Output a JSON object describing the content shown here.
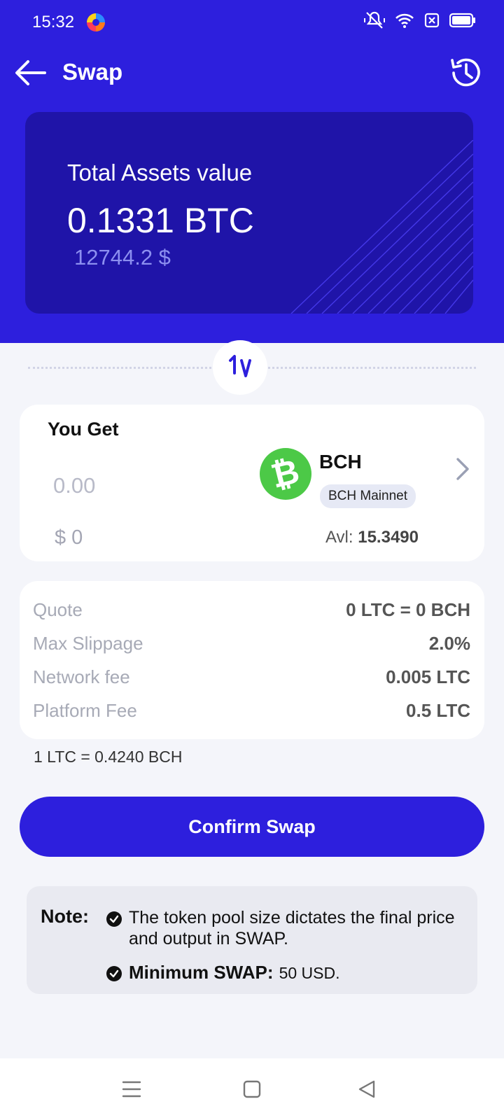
{
  "status_bar": {
    "time": "15:32",
    "icons": [
      "browser-app-icon",
      "mute-vibrate-icon",
      "wifi-icon",
      "sim-off-icon",
      "battery-icon"
    ]
  },
  "header": {
    "title": "Swap",
    "back_icon": "arrow-left-icon",
    "history_icon": "history-clock-icon"
  },
  "assets": {
    "label": "Total Assets value",
    "btc_value": "0.1331 BTC",
    "usd_value": "12744.2 $"
  },
  "get_card": {
    "title": "You Get",
    "amount_placeholder": "0.00",
    "usd_value": "$ 0",
    "token": {
      "symbol": "BCH",
      "network": "BCH Mainnet",
      "logo_color": "#4cc947"
    },
    "available_label": "Avl:",
    "available_value": "15.3490"
  },
  "info": {
    "rows": [
      {
        "label": "Quote",
        "value": "0 LTC = 0 BCH"
      },
      {
        "label": "Max Slippage",
        "value": "2.0%"
      },
      {
        "label": "Network fee",
        "value": "0.005 LTC"
      },
      {
        "label": "Platform Fee",
        "value": "0.5 LTC"
      }
    ]
  },
  "rate": "1 LTC = 0.4240 BCH",
  "confirm_label": "Confirm Swap",
  "note": {
    "label": "Note:",
    "item1": "The token pool size dictates the final price and output in SWAP.",
    "item2_label": "Minimum SWAP:",
    "item2_value": "50 USD."
  },
  "colors": {
    "primary": "#2d1fdd",
    "card_dark": "#1f14a8",
    "background": "#f4f5fa"
  }
}
